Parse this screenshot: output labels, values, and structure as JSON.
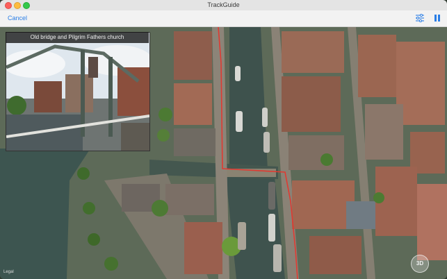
{
  "window": {
    "title": "TrackGuide"
  },
  "toolbar": {
    "cancel_label": "Cancel",
    "filter_icon": "sliders-icon",
    "pause_icon": "pause-icon",
    "accent": "#2a7ee6"
  },
  "photo": {
    "caption": "Old bridge and Pilgrim Fathers church"
  },
  "map": {
    "legal_label": "Legal",
    "view_3d_label": "3D",
    "route_color": "#e03a32"
  }
}
